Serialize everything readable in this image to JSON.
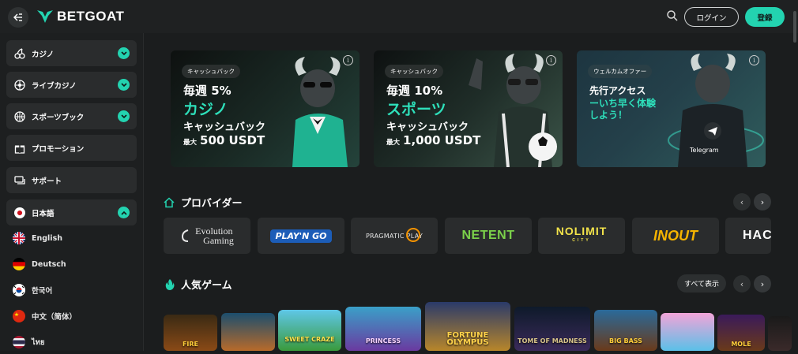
{
  "header": {
    "brand": "BETGOAT",
    "login_label": "ログイン",
    "register_label": "登録",
    "accent": "#23d3b0"
  },
  "sidebar": {
    "items": [
      {
        "label": "カジノ",
        "icon": "cherries-icon",
        "expandable": true
      },
      {
        "label": "ライブカジノ",
        "icon": "roulette-icon",
        "expandable": true
      },
      {
        "label": "スポーツブック",
        "icon": "basketball-icon",
        "expandable": true
      },
      {
        "label": "プロモーション",
        "icon": "gift-icon",
        "expandable": false
      },
      {
        "label": "サポート",
        "icon": "chat-icon",
        "expandable": false
      }
    ],
    "language_selected": "日本語",
    "languages": [
      "English",
      "Deutsch",
      "한국어",
      "中文（简体）",
      "ไทย"
    ]
  },
  "banners": [
    {
      "tag": "キャッシュバック",
      "line1": "毎週 5%",
      "line2": "カジノ",
      "line3": "キャッシュバック",
      "prefix": "最大",
      "amount": "500 USDT"
    },
    {
      "tag": "キャッシュバック",
      "line1": "毎週 10%",
      "line2": "スポーツ",
      "line3": "キャッシュバック",
      "prefix": "最大",
      "amount": "1,000 USDT"
    },
    {
      "tag": "ウェルカムオファー",
      "title": "先行アクセス",
      "body": "ーいち早く体験しよう！",
      "badge": "Telegram"
    }
  ],
  "providers_section": {
    "title": "プロバイダー",
    "providers": [
      {
        "name_line1": "Evolution",
        "name_line2": "Gaming"
      },
      {
        "name": "PLAY'N GO"
      },
      {
        "name": "PRAGMATIC PLAY"
      },
      {
        "name": "NETENT"
      },
      {
        "name": "NOLIMIT",
        "sub": "CITY"
      },
      {
        "name": "INOUT"
      },
      {
        "name": "HACKS"
      }
    ]
  },
  "games_section": {
    "title": "人気ゲーム",
    "show_all_label": "すべて表示",
    "games": [
      {
        "title": "FIRE"
      },
      {
        "title": ""
      },
      {
        "title": "SWEET CRAZE"
      },
      {
        "title": "PRINCESS"
      },
      {
        "title": "FORTUNE OLYMPUS"
      },
      {
        "title": "TOME OF MADNESS"
      },
      {
        "title": "BIG BASS"
      },
      {
        "title": ""
      },
      {
        "title": "MOLE"
      },
      {
        "title": ""
      }
    ]
  },
  "icons": {
    "info": "i",
    "prev": "‹",
    "next": "›"
  }
}
